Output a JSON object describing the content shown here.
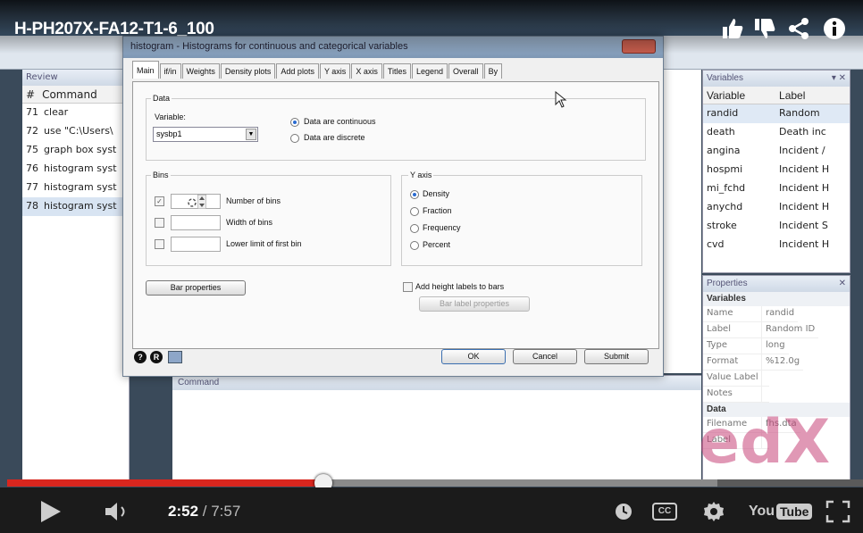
{
  "video": {
    "title": "H-PH207X-FA12-T1-6_100",
    "time_current": "2:52",
    "time_sep": " / ",
    "time_total": "7:57",
    "progress_fraction": 0.37,
    "buffered_fraction": 0.83,
    "icons": [
      "like-icon",
      "dislike-icon",
      "share-icon",
      "info-icon",
      "play-icon",
      "volume-icon",
      "watch-later-icon",
      "captions-icon",
      "settings-icon",
      "youtube-logo",
      "fullscreen-icon"
    ],
    "captions_label": "CC",
    "youtube_logo_text": "You",
    "youtube_logo_tube": "Tube"
  },
  "watermark": {
    "text": "edX"
  },
  "stata": {
    "review_header": "Review",
    "review_cols": [
      "#",
      "Command"
    ],
    "review_rows": [
      {
        "num": "71",
        "cmd": "clear"
      },
      {
        "num": "72",
        "cmd": "use \"C:\\Users\\"
      },
      {
        "num": "75",
        "cmd": "graph box syst"
      },
      {
        "num": "76",
        "cmd": "histogram syst"
      },
      {
        "num": "77",
        "cmd": "histogram syst"
      },
      {
        "num": "78",
        "cmd": "histogram syst"
      }
    ],
    "command_header": "Command",
    "variables_header": "Variables",
    "variables_cols": [
      "Variable",
      "Label"
    ],
    "variables_rows": [
      {
        "name": "randid",
        "label": "Random"
      },
      {
        "name": "death",
        "label": "Death inc"
      },
      {
        "name": "angina",
        "label": "Incident /"
      },
      {
        "name": "hospmi",
        "label": "Incident H"
      },
      {
        "name": "mi_fchd",
        "label": "Incident H"
      },
      {
        "name": "anychd",
        "label": "Incident H"
      },
      {
        "name": "stroke",
        "label": "Incident S"
      },
      {
        "name": "cvd",
        "label": "Incident H"
      }
    ],
    "properties_header": "Properties",
    "properties_section_vars": "Variables",
    "properties_rows": [
      {
        "k": "Name",
        "v": "randid"
      },
      {
        "k": "Label",
        "v": "Random ID"
      },
      {
        "k": "Type",
        "v": "long"
      },
      {
        "k": "Format",
        "v": "%12.0g"
      },
      {
        "k": "Value Label",
        "v": ""
      },
      {
        "k": "Notes",
        "v": ""
      }
    ],
    "properties_section_data": "Data",
    "properties_filename_k": "Filename",
    "properties_filename_v": "fhs.dta",
    "properties_label_k": "Label"
  },
  "dialog": {
    "title": "histogram - Histograms for continuous and categorical variables",
    "tabs": [
      "Main",
      "if/in",
      "Weights",
      "Density plots",
      "Add plots",
      "Y axis",
      "X axis",
      "Titles",
      "Legend",
      "Overall",
      "By"
    ],
    "data_group": "Data",
    "variable_label": "Variable:",
    "variable_value": "sysbp1",
    "radio_continuous": "Data are continuous",
    "radio_discrete": "Data are discrete",
    "bins_group": "Bins",
    "number_of_bins": "Number of bins",
    "width_of_bins": "Width of bins",
    "lower_limit": "Lower limit of first bin",
    "yaxis_group": "Y axis",
    "yaxis_options": [
      "Density",
      "Fraction",
      "Frequency",
      "Percent"
    ],
    "bar_properties": "Bar properties",
    "add_height_labels": "Add height labels to bars",
    "bar_label_properties": "Bar label properties",
    "ok": "OK",
    "cancel": "Cancel",
    "submit": "Submit"
  }
}
